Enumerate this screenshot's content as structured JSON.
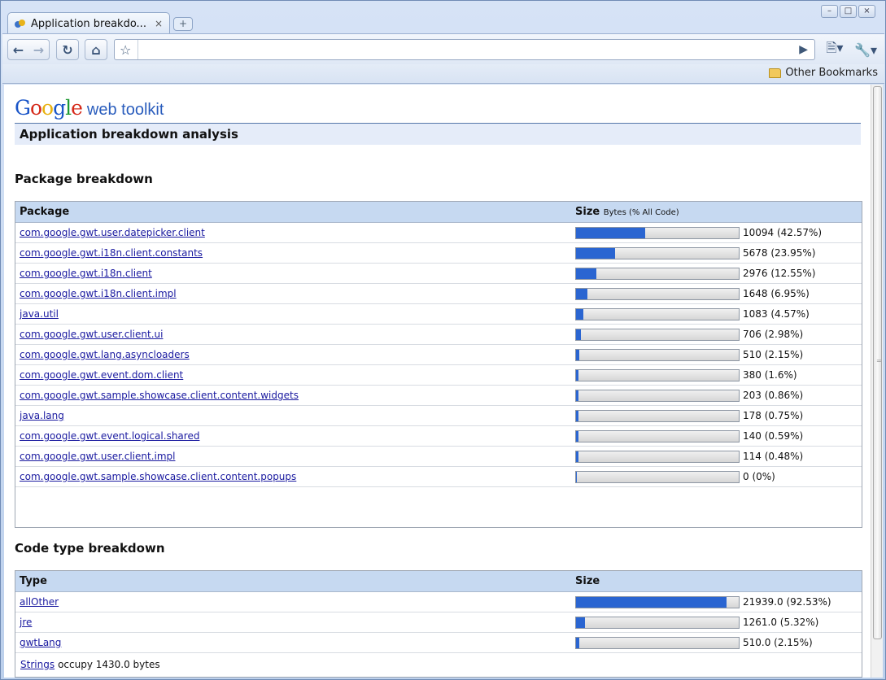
{
  "browser": {
    "tab_title": "Application breakdo...",
    "tab_close": "×",
    "new_tab": "+",
    "window_controls": [
      "–",
      "□",
      "×"
    ],
    "bookmarks_other": "Other Bookmarks",
    "icons": [
      "back-icon",
      "forward-icon",
      "reload-icon",
      "home-icon",
      "star-icon",
      "go-icon",
      "page-menu-icon",
      "wrench-icon",
      "folder-icon"
    ]
  },
  "page": {
    "logo_sub": "web toolkit",
    "title": "Application breakdown analysis",
    "package_section": {
      "heading": "Package breakdown",
      "col_package": "Package",
      "col_size": "Size",
      "col_size_note": "Bytes (% All Code)",
      "rows": [
        {
          "name": "com.google.gwt.user.datepicker.client",
          "value": "10094 (42.57%)",
          "pct": 42.57
        },
        {
          "name": "com.google.gwt.i18n.client.constants",
          "value": "5678 (23.95%)",
          "pct": 23.95
        },
        {
          "name": "com.google.gwt.i18n.client",
          "value": "2976 (12.55%)",
          "pct": 12.55
        },
        {
          "name": "com.google.gwt.i18n.client.impl",
          "value": "1648 (6.95%)",
          "pct": 6.95
        },
        {
          "name": "java.util",
          "value": "1083 (4.57%)",
          "pct": 4.57
        },
        {
          "name": "com.google.gwt.user.client.ui",
          "value": "706 (2.98%)",
          "pct": 2.98
        },
        {
          "name": "com.google.gwt.lang.asyncloaders",
          "value": "510 (2.15%)",
          "pct": 2.15
        },
        {
          "name": "com.google.gwt.event.dom.client",
          "value": "380 (1.6%)",
          "pct": 1.6
        },
        {
          "name": "com.google.gwt.sample.showcase.client.content.widgets",
          "value": "203 (0.86%)",
          "pct": 0.86
        },
        {
          "name": "java.lang",
          "value": "178 (0.75%)",
          "pct": 0.75
        },
        {
          "name": "com.google.gwt.event.logical.shared",
          "value": "140 (0.59%)",
          "pct": 0.59
        },
        {
          "name": "com.google.gwt.user.client.impl",
          "value": "114 (0.48%)",
          "pct": 0.48
        },
        {
          "name": "com.google.gwt.sample.showcase.client.content.popups",
          "value": "0 (0%)",
          "pct": 0
        }
      ]
    },
    "code_type_section": {
      "heading": "Code type breakdown",
      "col_type": "Type",
      "col_size": "Size",
      "rows": [
        {
          "name": "allOther",
          "value": "21939.0 (92.53%)",
          "pct": 92.53
        },
        {
          "name": "jre",
          "value": "1261.0 (5.32%)",
          "pct": 5.32
        },
        {
          "name": "gwtLang",
          "value": "510.0 (2.15%)",
          "pct": 2.15
        }
      ],
      "strings_link": "Strings",
      "strings_text": "occupy 1430.0 bytes"
    }
  }
}
